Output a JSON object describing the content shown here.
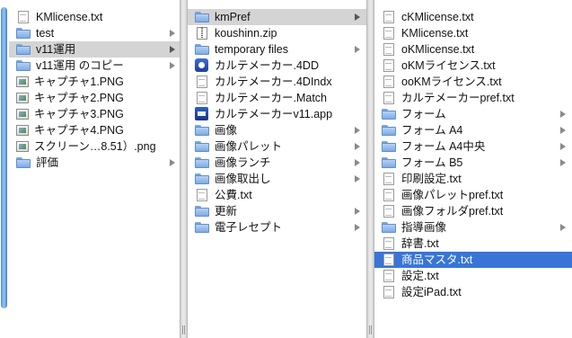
{
  "columns": [
    {
      "name": "v11-parent",
      "items": [
        {
          "label": "KMlicense.txt",
          "icon": "document-icon",
          "folder": false
        },
        {
          "label": "test",
          "icon": "folder-icon",
          "folder": true
        },
        {
          "label": "v11運用",
          "icon": "folder-icon",
          "folder": true,
          "selected": "gray"
        },
        {
          "label": "v11運用 のコピー",
          "icon": "folder-icon",
          "folder": true
        },
        {
          "label": "キャプチャ1.PNG",
          "icon": "image-icon",
          "folder": false
        },
        {
          "label": "キャプチャ2.PNG",
          "icon": "image-icon",
          "folder": false
        },
        {
          "label": "キャプチャ3.PNG",
          "icon": "image-icon",
          "folder": false
        },
        {
          "label": "キャプチャ4.PNG",
          "icon": "image-icon",
          "folder": false
        },
        {
          "label": "スクリーン…8.51）.png",
          "icon": "image-icon",
          "folder": false
        },
        {
          "label": "評価",
          "icon": "folder-icon",
          "folder": true
        }
      ]
    },
    {
      "name": "v11運用",
      "items": [
        {
          "label": "kmPref",
          "icon": "folder-icon",
          "folder": true,
          "selected": "gray"
        },
        {
          "label": "koushinn.zip",
          "icon": "zip-icon",
          "folder": false
        },
        {
          "label": "temporary files",
          "icon": "folder-icon",
          "folder": true
        },
        {
          "label": "カルテメーカー.4DD",
          "icon": "app-data-icon",
          "folder": false
        },
        {
          "label": "カルテメーカー.4DIndx",
          "icon": "document-icon",
          "folder": false
        },
        {
          "label": "カルテメーカー.Match",
          "icon": "document-icon",
          "folder": false
        },
        {
          "label": "カルテメーカーv11.app",
          "icon": "application-icon",
          "folder": false
        },
        {
          "label": "画像",
          "icon": "folder-icon",
          "folder": true
        },
        {
          "label": "画像パレット",
          "icon": "folder-icon",
          "folder": true
        },
        {
          "label": "画像ランチ",
          "icon": "folder-icon",
          "folder": true
        },
        {
          "label": "画像取出し",
          "icon": "folder-icon",
          "folder": true
        },
        {
          "label": "公費.txt",
          "icon": "document-icon",
          "folder": false
        },
        {
          "label": "更新",
          "icon": "folder-icon",
          "folder": true
        },
        {
          "label": "電子レセプト",
          "icon": "folder-icon",
          "folder": true
        }
      ]
    },
    {
      "name": "kmPref",
      "items": [
        {
          "label": "cKMlicense.txt",
          "icon": "document-icon",
          "folder": false
        },
        {
          "label": "KMlicense.txt",
          "icon": "document-icon",
          "folder": false
        },
        {
          "label": "oKMlicense.txt",
          "icon": "document-icon",
          "folder": false
        },
        {
          "label": "oKMライセンス.txt",
          "icon": "document-icon",
          "folder": false
        },
        {
          "label": "ooKMライセンス.txt",
          "icon": "document-icon",
          "folder": false
        },
        {
          "label": "カルテメーカーpref.txt",
          "icon": "document-icon",
          "folder": false
        },
        {
          "label": "フォーム",
          "icon": "folder-icon",
          "folder": true
        },
        {
          "label": "フォーム A4",
          "icon": "folder-icon",
          "folder": true
        },
        {
          "label": "フォーム A4中央",
          "icon": "folder-icon",
          "folder": true
        },
        {
          "label": "フォーム B5",
          "icon": "folder-icon",
          "folder": true
        },
        {
          "label": "印刷設定.txt",
          "icon": "document-icon",
          "folder": false
        },
        {
          "label": "画像パレットpref.txt",
          "icon": "document-icon",
          "folder": false
        },
        {
          "label": "画像フォルダpref.txt",
          "icon": "document-icon",
          "folder": false
        },
        {
          "label": "指導画像",
          "icon": "folder-icon",
          "folder": true
        },
        {
          "label": "辞書.txt",
          "icon": "document-icon",
          "folder": false
        },
        {
          "label": "商品マスタ.txt",
          "icon": "document-icon",
          "folder": false,
          "selected": "blue"
        },
        {
          "label": "設定.txt",
          "icon": "document-icon",
          "folder": false
        },
        {
          "label": "設定iPad.txt",
          "icon": "document-icon",
          "folder": false
        }
      ]
    }
  ],
  "colors": {
    "selection_active": "#3875d7",
    "selection_inactive": "#d4d4d4",
    "scroll_thumb": "#4d8fe0"
  }
}
